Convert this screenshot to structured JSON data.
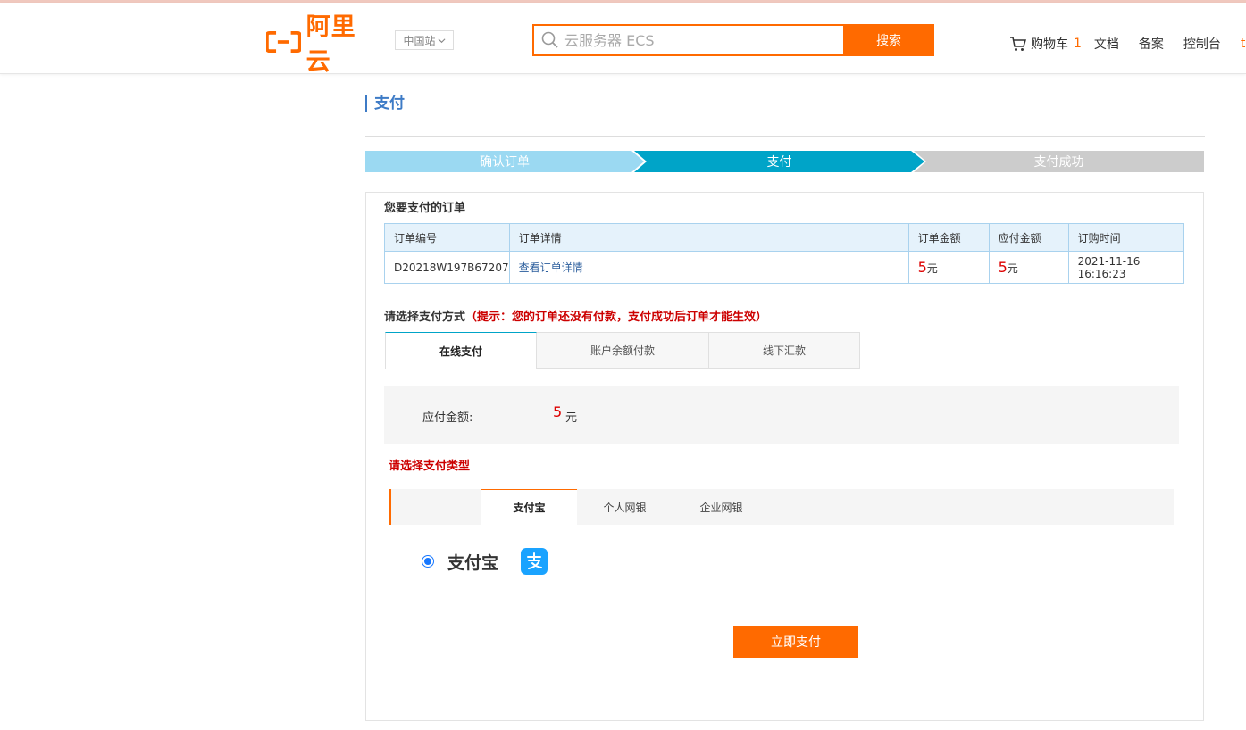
{
  "header": {
    "brand": "阿里云",
    "region": "中国站",
    "search": {
      "placeholder": "云服务器 ECS",
      "button": "搜索"
    },
    "nav": {
      "cart_label": "购物车",
      "cart_count": "1",
      "docs": "文档",
      "beian": "备案",
      "console": "控制台",
      "user": "tb"
    }
  },
  "page": {
    "title": "支付"
  },
  "steps": [
    "确认订单",
    "支付",
    "支付成功"
  ],
  "order": {
    "section_title": "您要支付的订单",
    "columns": [
      "订单编号",
      "订单详情",
      "订单金额",
      "应付金额",
      "订购时间"
    ],
    "row": {
      "order_id": "D20218W197B67207",
      "details_link": "查看订单详情",
      "amount": "5",
      "payable": "5",
      "unit": "元",
      "time": "2021-11-16 16:16:23"
    }
  },
  "payment": {
    "method_title": "请选择支付方式",
    "tip": "（提示：您的订单还没有付款，支付成功后订单才能生效）",
    "tabs": [
      "在线支付",
      "账户余额付款",
      "线下汇款"
    ],
    "amount_label": "应付金额:",
    "amount_value": "5",
    "amount_unit": "元",
    "type_title": "请选择支付类型",
    "subtabs": [
      "支付宝",
      "个人网银",
      "企业网银"
    ],
    "selected_option": "支付宝",
    "pay_button": "立即支付"
  },
  "colors": {
    "accent": "#ff6a00",
    "step_active": "#00a4c8",
    "step_done": "#9bd9f2",
    "alipay": "#1aa3ff"
  },
  "icons": [
    "search-icon",
    "chevron-down-icon",
    "cart-icon",
    "alipay-logo-icon"
  ]
}
